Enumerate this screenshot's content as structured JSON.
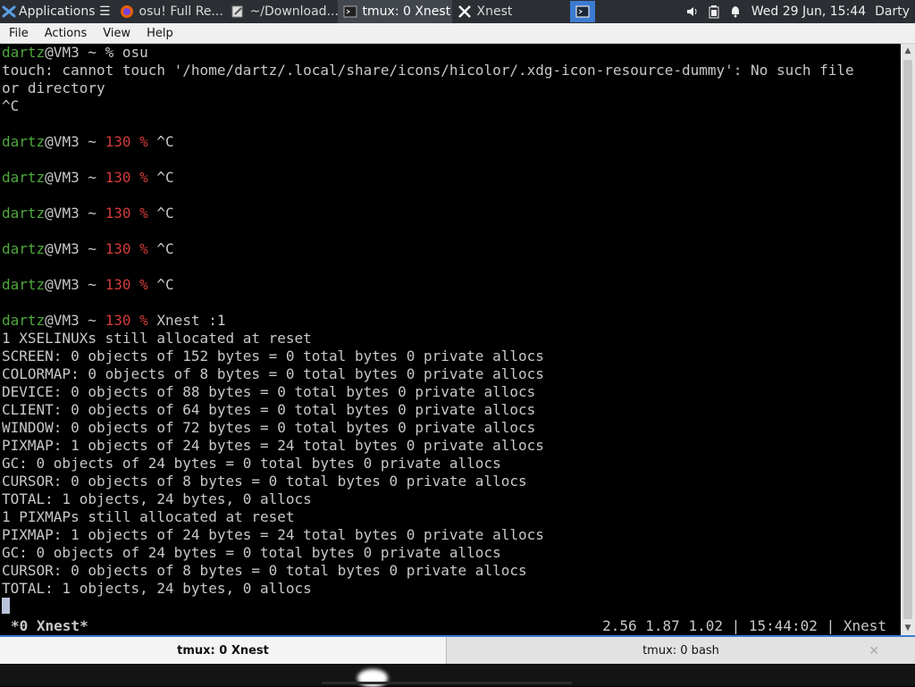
{
  "panel": {
    "applications_label": "Applications ☰",
    "tasks": [
      {
        "label": "osu! Full Re...",
        "icon": "firefox-icon"
      },
      {
        "label": "~/Download...",
        "icon": "text-editor-icon"
      },
      {
        "label": "tmux: 0 Xnest",
        "icon": "terminal-icon",
        "active": true
      },
      {
        "label": "Xnest",
        "icon": "x-logo-icon"
      }
    ],
    "clock": "Wed 29 Jun, 15:44",
    "user": "Darty",
    "tray_icons": [
      "volume-icon",
      "battery-icon",
      "notification-bell-icon"
    ]
  },
  "menubar": {
    "items": [
      "File",
      "Actions",
      "View",
      "Help"
    ]
  },
  "terminal": {
    "prompt_user": "dartz",
    "prompt_host": "@VM3 ~ ",
    "exit_code": "130 %",
    "lines": {
      "l1_cmd": "% osu",
      "l2": "touch: cannot touch '/home/dartz/.local/share/icons/hicolor/.xdg-icon-resource-dummy': No such file",
      "l3": "or directory",
      "l4": "^C",
      "ctrlc": " ^C",
      "xnest_cmd": " Xnest :1",
      "out": [
        "1 XSELINUXs still allocated at reset",
        "SCREEN: 0 objects of 152 bytes = 0 total bytes 0 private allocs",
        "COLORMAP: 0 objects of 8 bytes = 0 total bytes 0 private allocs",
        "DEVICE: 0 objects of 88 bytes = 0 total bytes 0 private allocs",
        "CLIENT: 0 objects of 64 bytes = 0 total bytes 0 private allocs",
        "WINDOW: 0 objects of 72 bytes = 0 total bytes 0 private allocs",
        "PIXMAP: 1 objects of 24 bytes = 24 total bytes 0 private allocs",
        "GC: 0 objects of 24 bytes = 0 total bytes 0 private allocs",
        "CURSOR: 0 objects of 8 bytes = 0 total bytes 0 private allocs",
        "TOTAL: 1 objects, 24 bytes, 0 allocs",
        "1 PIXMAPs still allocated at reset",
        "PIXMAP: 1 objects of 24 bytes = 24 total bytes 0 private allocs",
        "GC: 0 objects of 24 bytes = 0 total bytes 0 private allocs",
        "CURSOR: 0 objects of 8 bytes = 0 total bytes 0 private allocs",
        "TOTAL: 1 objects, 24 bytes, 0 allocs"
      ]
    },
    "status_left": "*0 Xnest*",
    "status_right": "2.56 1.87 1.02 | 15:44:02 | Xnest"
  },
  "tabs": [
    {
      "label": "tmux: 0 Xnest",
      "active": true
    },
    {
      "label": "tmux: 0 bash",
      "active": false
    }
  ],
  "colors": {
    "prompt_green": "#4ea83c",
    "exit_red": "#d23a3a",
    "accent_blue": "#3c7bd0"
  }
}
